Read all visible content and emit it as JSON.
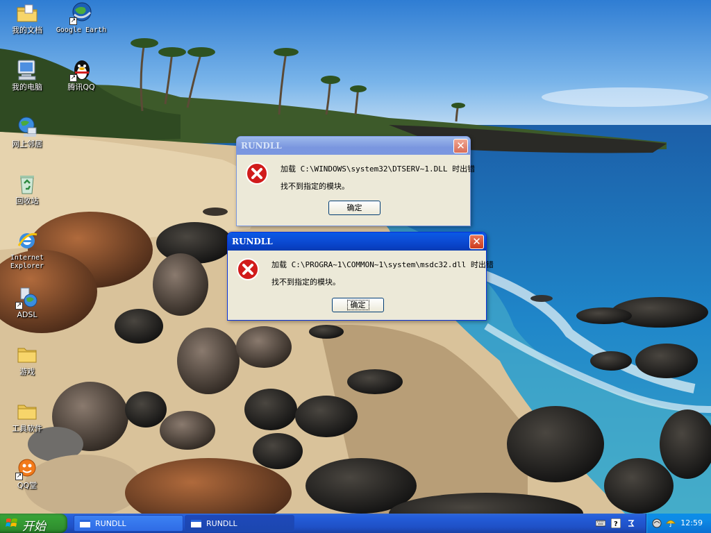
{
  "desktop": {
    "icons": [
      {
        "label": "我的文档"
      },
      {
        "label": "Google Earth"
      },
      {
        "label": "我的电脑"
      },
      {
        "label": "腾讯QQ"
      },
      {
        "label": "网上邻居"
      },
      {
        "label": "回收站"
      },
      {
        "label": "Internet Explorer"
      },
      {
        "label": "ADSL"
      },
      {
        "label": "游戏"
      },
      {
        "label": "工具软件"
      },
      {
        "label": "QQ堂"
      }
    ]
  },
  "dialogs": [
    {
      "title": "RUNDLL",
      "line1": "加载 C:\\WINDOWS\\system32\\DTSERV~1.DLL 时出错",
      "line2": "找不到指定的模块。",
      "ok": "确定",
      "close": "✕",
      "state": "inactive"
    },
    {
      "title": "RUNDLL",
      "line1": "加载 C:\\PROGRA~1\\COMMON~1\\system\\msdc32.dll 时出错",
      "line2": "找不到指定的模块。",
      "ok": "确定",
      "close": "✕",
      "state": "active"
    }
  ],
  "taskbar": {
    "start_label": "开始",
    "buttons": [
      {
        "label": "RUNDLL"
      },
      {
        "label": "RUNDLL"
      }
    ],
    "clock": "12:59"
  },
  "colors": {
    "titlebar_active": "#0a5ae6",
    "taskbar": "#245edb",
    "start_button": "#37a135",
    "error_icon": "#d11b1b"
  }
}
